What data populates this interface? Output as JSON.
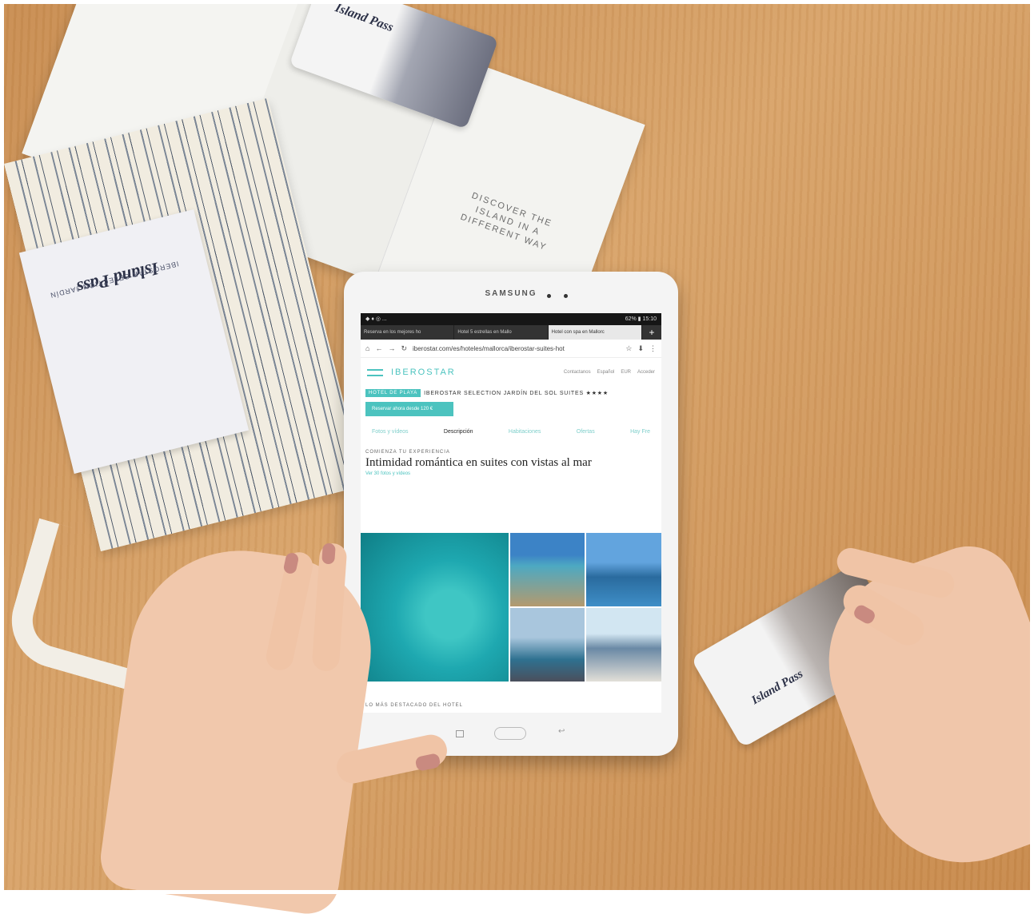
{
  "brochure": {
    "card_title": "Island Pass",
    "slogan": "DISCOVER THE ISLAND IN A DIFFERENT WAY"
  },
  "pouch": {
    "card_title": "Island Pass",
    "card_subtitle": "IBEROSTAR SELECTION JARDÍN"
  },
  "tablet": {
    "brand": "SAMSUNG",
    "status": {
      "left": "◆ ♦ ◎ ...",
      "right": "62% ▮ 15:10"
    },
    "tabs": [
      {
        "label": "Reserva en los mejores ho",
        "active": false
      },
      {
        "label": "Hotel 5 estrellas en Mallo",
        "active": false
      },
      {
        "label": "Hotel con spa en Mallorc",
        "active": true
      }
    ],
    "url": "iberostar.com/es/hoteles/mallorca/iberostar-suites-hot",
    "site": {
      "logo": "IBEROSTAR",
      "menu_label": "Menú",
      "nav": [
        "Contactanos",
        "Español",
        "EUR",
        "Acceder"
      ],
      "badge": "HOTEL DE PLAYA",
      "hotel_name": "IBEROSTAR SELECTION JARDÍN DEL SOL SUITES ★★★★",
      "book_label": "Reservar ahora desde 120 €",
      "sections": [
        "Fotos y vídeos",
        "Descripción",
        "Habitaciones",
        "Ofertas",
        "Hay Fre"
      ],
      "active_section": "Descripción",
      "eyebrow": "COMIENZA TU EXPERIENCIA",
      "headline": "Intimidad romántica en suites con vistas al mar",
      "photos_link": "Ver 30 fotos y vídeos",
      "highlights": "LO MÁS DESTACADO DEL HOTEL"
    }
  },
  "right_card": {
    "title": "Island Pass"
  }
}
